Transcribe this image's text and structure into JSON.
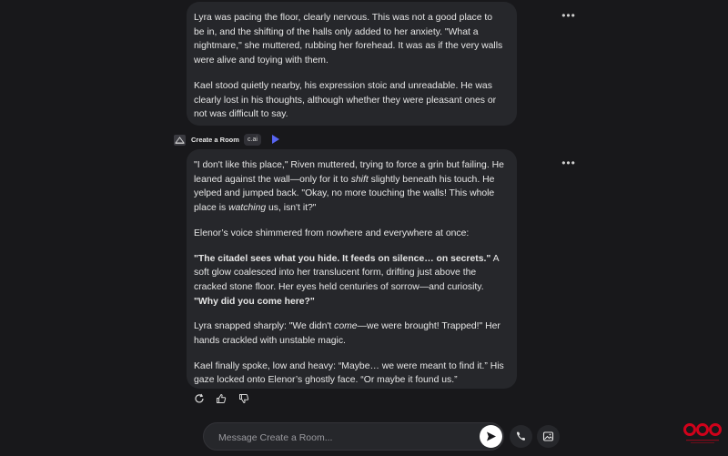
{
  "messages": [
    {
      "paragraphs": [
        "Lyra was pacing the floor, clearly nervous. This was not a good place to be in, and the shifting of the halls only added to her anxiety. \"What a nightmare,\" she muttered, rubbing her forehead. It was as if the very walls were alive and toying with them.",
        "Kael stood quietly nearby, his expression stoic and unreadable. He was clearly lost in his thoughts, although whether they were pleasant ones or not was difficult to say."
      ]
    },
    {
      "author": "Create a Room",
      "badge": "c.ai",
      "p1_a": "\"I don't like this place,\" Riven muttered, trying to force a grin but failing. He leaned against the wall—only for it to ",
      "p1_b": "shift",
      "p1_c": " slightly beneath his touch. He yelped and jumped back. \"Okay, no more touching the walls! This whole place is ",
      "p1_d": "watching",
      "p1_e": " us, isn't it?\"",
      "p2": "Elenor’s voice shimmered from nowhere and everywhere at once:",
      "p3_a": "\"The citadel sees what you hide. It feeds on silence… on secrets.\"",
      "p3_b": " A soft glow coalesced into her translucent form, drifting just above the cracked stone floor. Her eyes held centuries of sorrow—and curiosity. ",
      "p3_c": "\"Why did you come here?\"",
      "p4_a": "Lyra snapped sharply: \"We didn't ",
      "p4_b": "come",
      "p4_c": "—we were brought! Trapped!\" Her hands crackled with unstable magic.",
      "p5": "Kael finally spoke, low and heavy: “Maybe… we were meant to find it.” His gaze locked onto Elenor’s ghostly face. “Or maybe it found us.”"
    }
  ],
  "icons": {
    "more": "more-options-icon",
    "voice": "play-voice-icon",
    "regenerate": "regenerate-icon",
    "like": "thumbs-up-icon",
    "dislike": "thumbs-down-icon",
    "send": "send-icon",
    "call": "phone-icon",
    "media": "image-icon",
    "logo": "watermark-logo"
  },
  "input": {
    "placeholder": "Message Create a Room..."
  },
  "colors": {
    "background": "#18181b",
    "bubble": "#26272b",
    "accent": "#5865f2",
    "logo": "#d0021b"
  }
}
